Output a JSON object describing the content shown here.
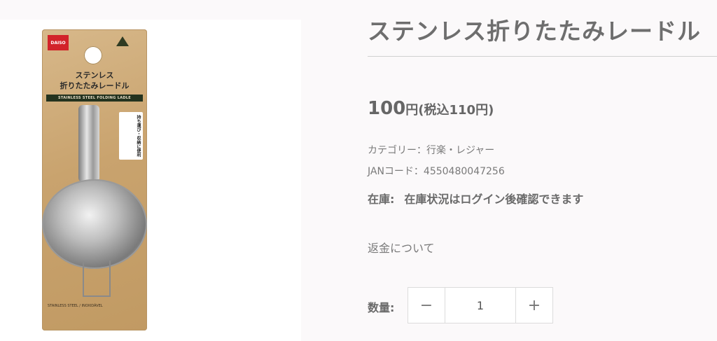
{
  "product": {
    "title": "ステンレス折りたたみレードル",
    "image": {
      "logo_text": "DAISO",
      "package_title_line1": "ステンレス",
      "package_title_line2": "折りたたみレードル",
      "package_band": "STAINLESS STEEL FOLDING LADLE",
      "package_tag": "持ち運び・収納に便利",
      "package_footer": "STAINLESS STEEL / INOXIDÁVEL"
    },
    "price": {
      "amount": "100",
      "suffix": "円(税込110円)"
    },
    "category": "カテゴリー：行楽・レジャー",
    "jan": "JANコード：4550480047256",
    "stock": {
      "label": "在庫:",
      "value": "在庫状況はログイン後確認できます"
    },
    "refund_link": "返金について",
    "quantity": {
      "label": "数量:",
      "value": "1",
      "minus": "−",
      "plus": "+"
    }
  },
  "colors": {
    "background": "#fbf9fa",
    "text": "#6a6a6a",
    "divider": "#d0d0d0",
    "package": "#c9a36e",
    "package_band": "#24331f"
  }
}
